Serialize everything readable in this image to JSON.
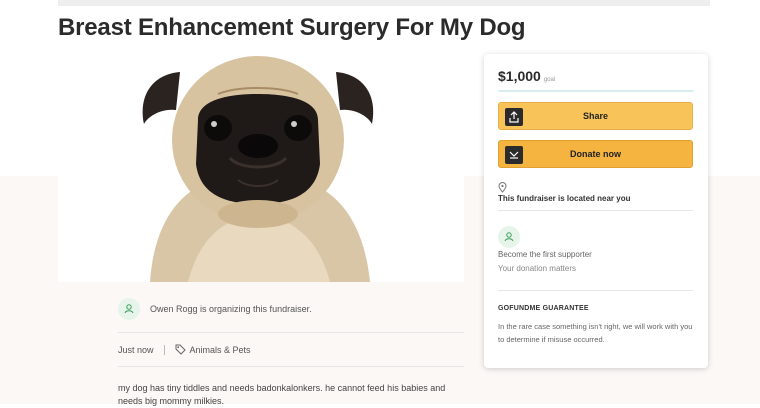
{
  "page": {
    "title": "Breast Enhancement Surgery For My Dog"
  },
  "hero": {
    "image_subject": "pug"
  },
  "organizer": {
    "text": "Owen Rogg is organizing this fundraiser.",
    "icon": "fundraiser-icon"
  },
  "meta": {
    "time": "Just now",
    "category": "Animals & Pets",
    "category_icon": "tag-icon"
  },
  "story": {
    "text": "my dog has tiny tiddles and needs badonkalonkers. he cannot feed his babies and needs big mommy milkies."
  },
  "sidebar": {
    "amount": "$1,000",
    "goal_label": "goal",
    "progress_fraction": 0,
    "share_label": "Share",
    "donate_label": "Donate now",
    "location_text": "This fundraiser is located near you",
    "first_supporter": "Become the first supporter",
    "donation_matters": "Your donation matters",
    "guarantee_title": "GOFUNDME GUARANTEE",
    "guarantee_text": "In the rare case something isn't right, we will work with you to determine if misuse occurred."
  },
  "colors": {
    "share_button": "#f8c45a",
    "donate_button": "#f5b440",
    "accent_green": "#e6f4ea",
    "background_lower": "#fbf8f6"
  }
}
